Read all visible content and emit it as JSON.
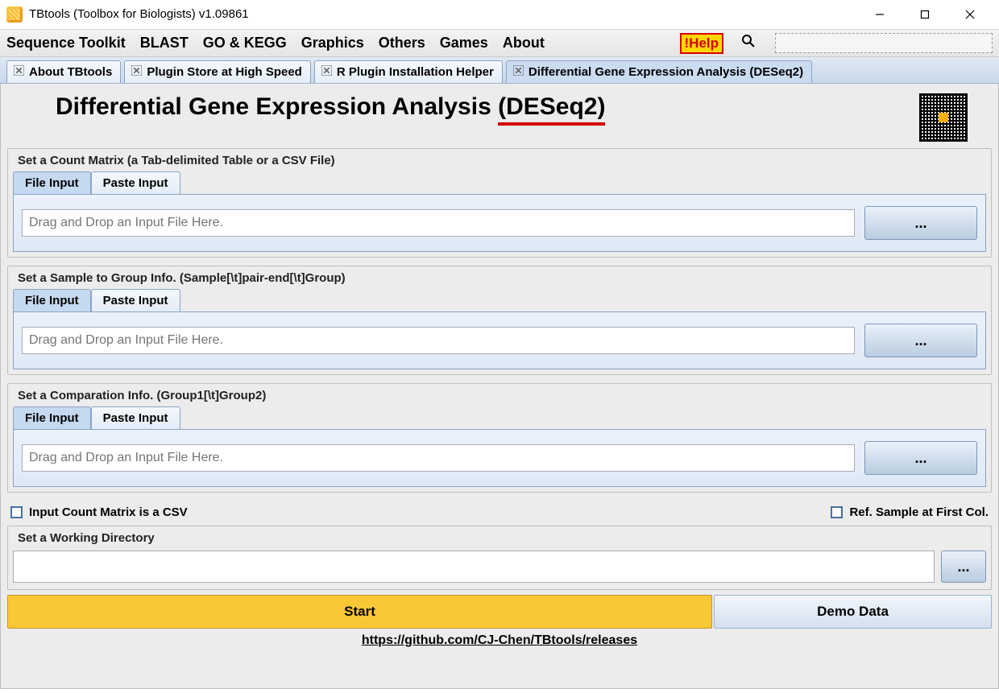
{
  "window": {
    "title": "TBtools (Toolbox for Biologists) v1.09861"
  },
  "menubar": {
    "items": [
      "Sequence Toolkit",
      "BLAST",
      "GO & KEGG",
      "Graphics",
      "Others",
      "Games",
      "About"
    ],
    "help_label": "!Help"
  },
  "tabs": [
    {
      "label": "About TBtools"
    },
    {
      "label": "Plugin Store at High Speed"
    },
    {
      "label": "R Plugin Installation Helper"
    },
    {
      "label": "Differential Gene Expression Analysis (DESeq2)"
    }
  ],
  "page": {
    "title_prefix": "Differential Gene Expression Analysis ",
    "title_suffix": "(DESeq2)"
  },
  "sections": {
    "count_matrix": {
      "legend": "Set a Count Matrix (a Tab-delimited Table or a CSV File)",
      "tab_file": "File Input",
      "tab_paste": "Paste Input",
      "placeholder": "Drag and Drop an Input File Here.",
      "browse": "..."
    },
    "sample_group": {
      "legend": "Set a Sample to Group Info. (Sample[\\t]pair-end[\\t]Group)",
      "tab_file": "File Input",
      "tab_paste": "Paste Input",
      "placeholder": "Drag and Drop an Input File Here.",
      "browse": "..."
    },
    "comparation": {
      "legend": "Set a Comparation Info. (Group1[\\t]Group2)",
      "tab_file": "File Input",
      "tab_paste": "Paste Input",
      "placeholder": "Drag and Drop an Input File Here.",
      "browse": "..."
    },
    "working_dir": {
      "legend": "Set a Working Directory",
      "browse": "..."
    }
  },
  "checkboxes": {
    "csv_label": "Input Count Matrix is a CSV",
    "ref_label": "Ref. Sample at First Col."
  },
  "actions": {
    "start": "Start",
    "demo": "Demo Data"
  },
  "footer": {
    "link": "https://github.com/CJ-Chen/TBtools/releases"
  }
}
